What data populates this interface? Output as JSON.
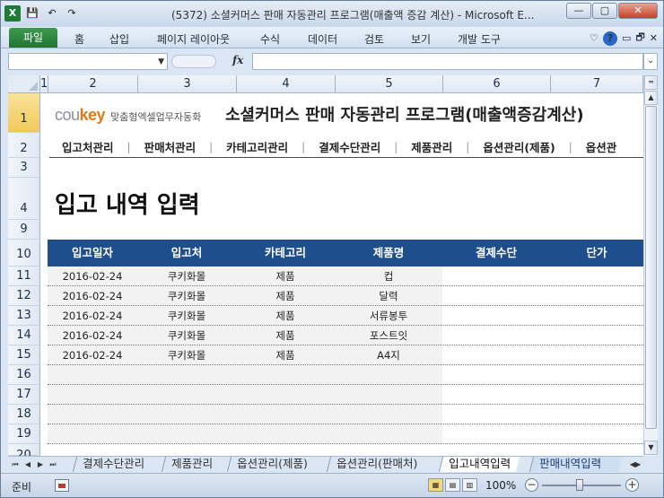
{
  "window": {
    "title": "(5372) 소셜커머스 판매 자동관리 프로그램(매출액 증감 계산) - Microsoft E...",
    "minimize": "—",
    "maximize": "▢",
    "close": "✕"
  },
  "qat": {
    "app_icon": "X",
    "save": "💾",
    "undo": "↶",
    "redo": "↷"
  },
  "ribbon": {
    "file_tab": "파일",
    "tabs": [
      "홈",
      "삽입",
      "페이지 레이아웃",
      "수식",
      "데이터",
      "검토",
      "보기",
      "개발 도구"
    ],
    "right": {
      "expand": "♡",
      "help": "?",
      "min": "▭",
      "restore": "🗗",
      "close": "✕"
    }
  },
  "formula_bar": {
    "name_box": "",
    "fx": "fx",
    "formula": ""
  },
  "columns": [
    "1",
    "2",
    "3",
    "4",
    "5",
    "6",
    "7"
  ],
  "rows": [
    "1",
    "2",
    "3",
    "4",
    "9",
    "10",
    "11",
    "12",
    "13",
    "14",
    "15",
    "16",
    "17",
    "18",
    "19",
    "20"
  ],
  "sheet": {
    "brand_logo_prefix": "cou",
    "brand_logo_suffix": "key",
    "brand_tagline": "맞춤형엑셀업무자동화",
    "app_title": "소셜커머스 판매 자동관리 프로그램(매출액증감계산)",
    "nav": [
      "입고처관리",
      "판매처관리",
      "카테고리관리",
      "결제수단관리",
      "제품관리",
      "옵션관리(제품)",
      "옵션관"
    ],
    "nav_sep": "|",
    "page_heading": "입고 내역 입력"
  },
  "table": {
    "headers": [
      "입고일자",
      "입고처",
      "카테고리",
      "제품명",
      "결제수단",
      "단가"
    ],
    "rows": [
      [
        "2016-02-24",
        "쿠키화몰",
        "제품",
        "컵",
        "",
        ""
      ],
      [
        "2016-02-24",
        "쿠키화몰",
        "제품",
        "달력",
        "",
        ""
      ],
      [
        "2016-02-24",
        "쿠키화몰",
        "제품",
        "서류봉투",
        "",
        ""
      ],
      [
        "2016-02-24",
        "쿠키화몰",
        "제품",
        "포스트잇",
        "",
        ""
      ],
      [
        "2016-02-24",
        "쿠키화몰",
        "제품",
        "A4지",
        "",
        ""
      ],
      [
        "",
        "",
        "",
        "",
        "",
        ""
      ],
      [
        "",
        "",
        "",
        "",
        "",
        ""
      ],
      [
        "",
        "",
        "",
        "",
        "",
        ""
      ],
      [
        "",
        "",
        "",
        "",
        "",
        ""
      ]
    ]
  },
  "sheet_tabs": [
    "결제수단관리",
    "제품관리",
    "옵션관리(제품)",
    "옵션관리(판매처)",
    "입고내역입력",
    "판매내역입력"
  ],
  "active_sheet": "입고내역입력",
  "tab_nav": [
    "⏮",
    "◀",
    "▶",
    "⏭"
  ],
  "status": {
    "ready": "준비",
    "zoom": "100%",
    "zoom_minus": "−",
    "zoom_plus": "+"
  },
  "colors": {
    "header_blue": "#1f4e8c",
    "file_tab_green": "#2a8a3f",
    "brand_orange": "#e07a1a"
  }
}
